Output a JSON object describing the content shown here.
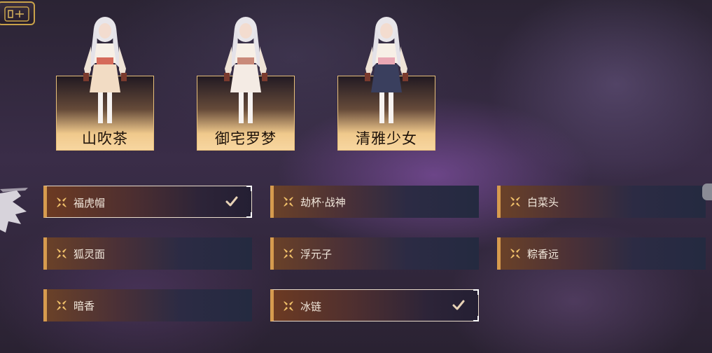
{
  "outfits": [
    {
      "name": "山吹茶"
    },
    {
      "name": "御宅罗梦"
    },
    {
      "name": "清雅少女"
    }
  ],
  "accessories": [
    {
      "label": "福虎帽",
      "selected": true
    },
    {
      "label": "劫杯·战神",
      "selected": false
    },
    {
      "label": "白菜头",
      "selected": false
    },
    {
      "label": "狐灵面",
      "selected": false
    },
    {
      "label": "浮元子",
      "selected": false
    },
    {
      "label": "粽香远",
      "selected": false
    },
    {
      "label": "暗香",
      "selected": false
    },
    {
      "label": "冰链",
      "selected": true
    }
  ],
  "colors": {
    "accent_gold": "#d69b4e",
    "plate_light": "#f7d6a0",
    "text_light": "#f2e8dc"
  },
  "icons": {
    "menu": "menu-icon",
    "slot_marker": "four-petal-icon",
    "selected": "checkmark-icon"
  }
}
